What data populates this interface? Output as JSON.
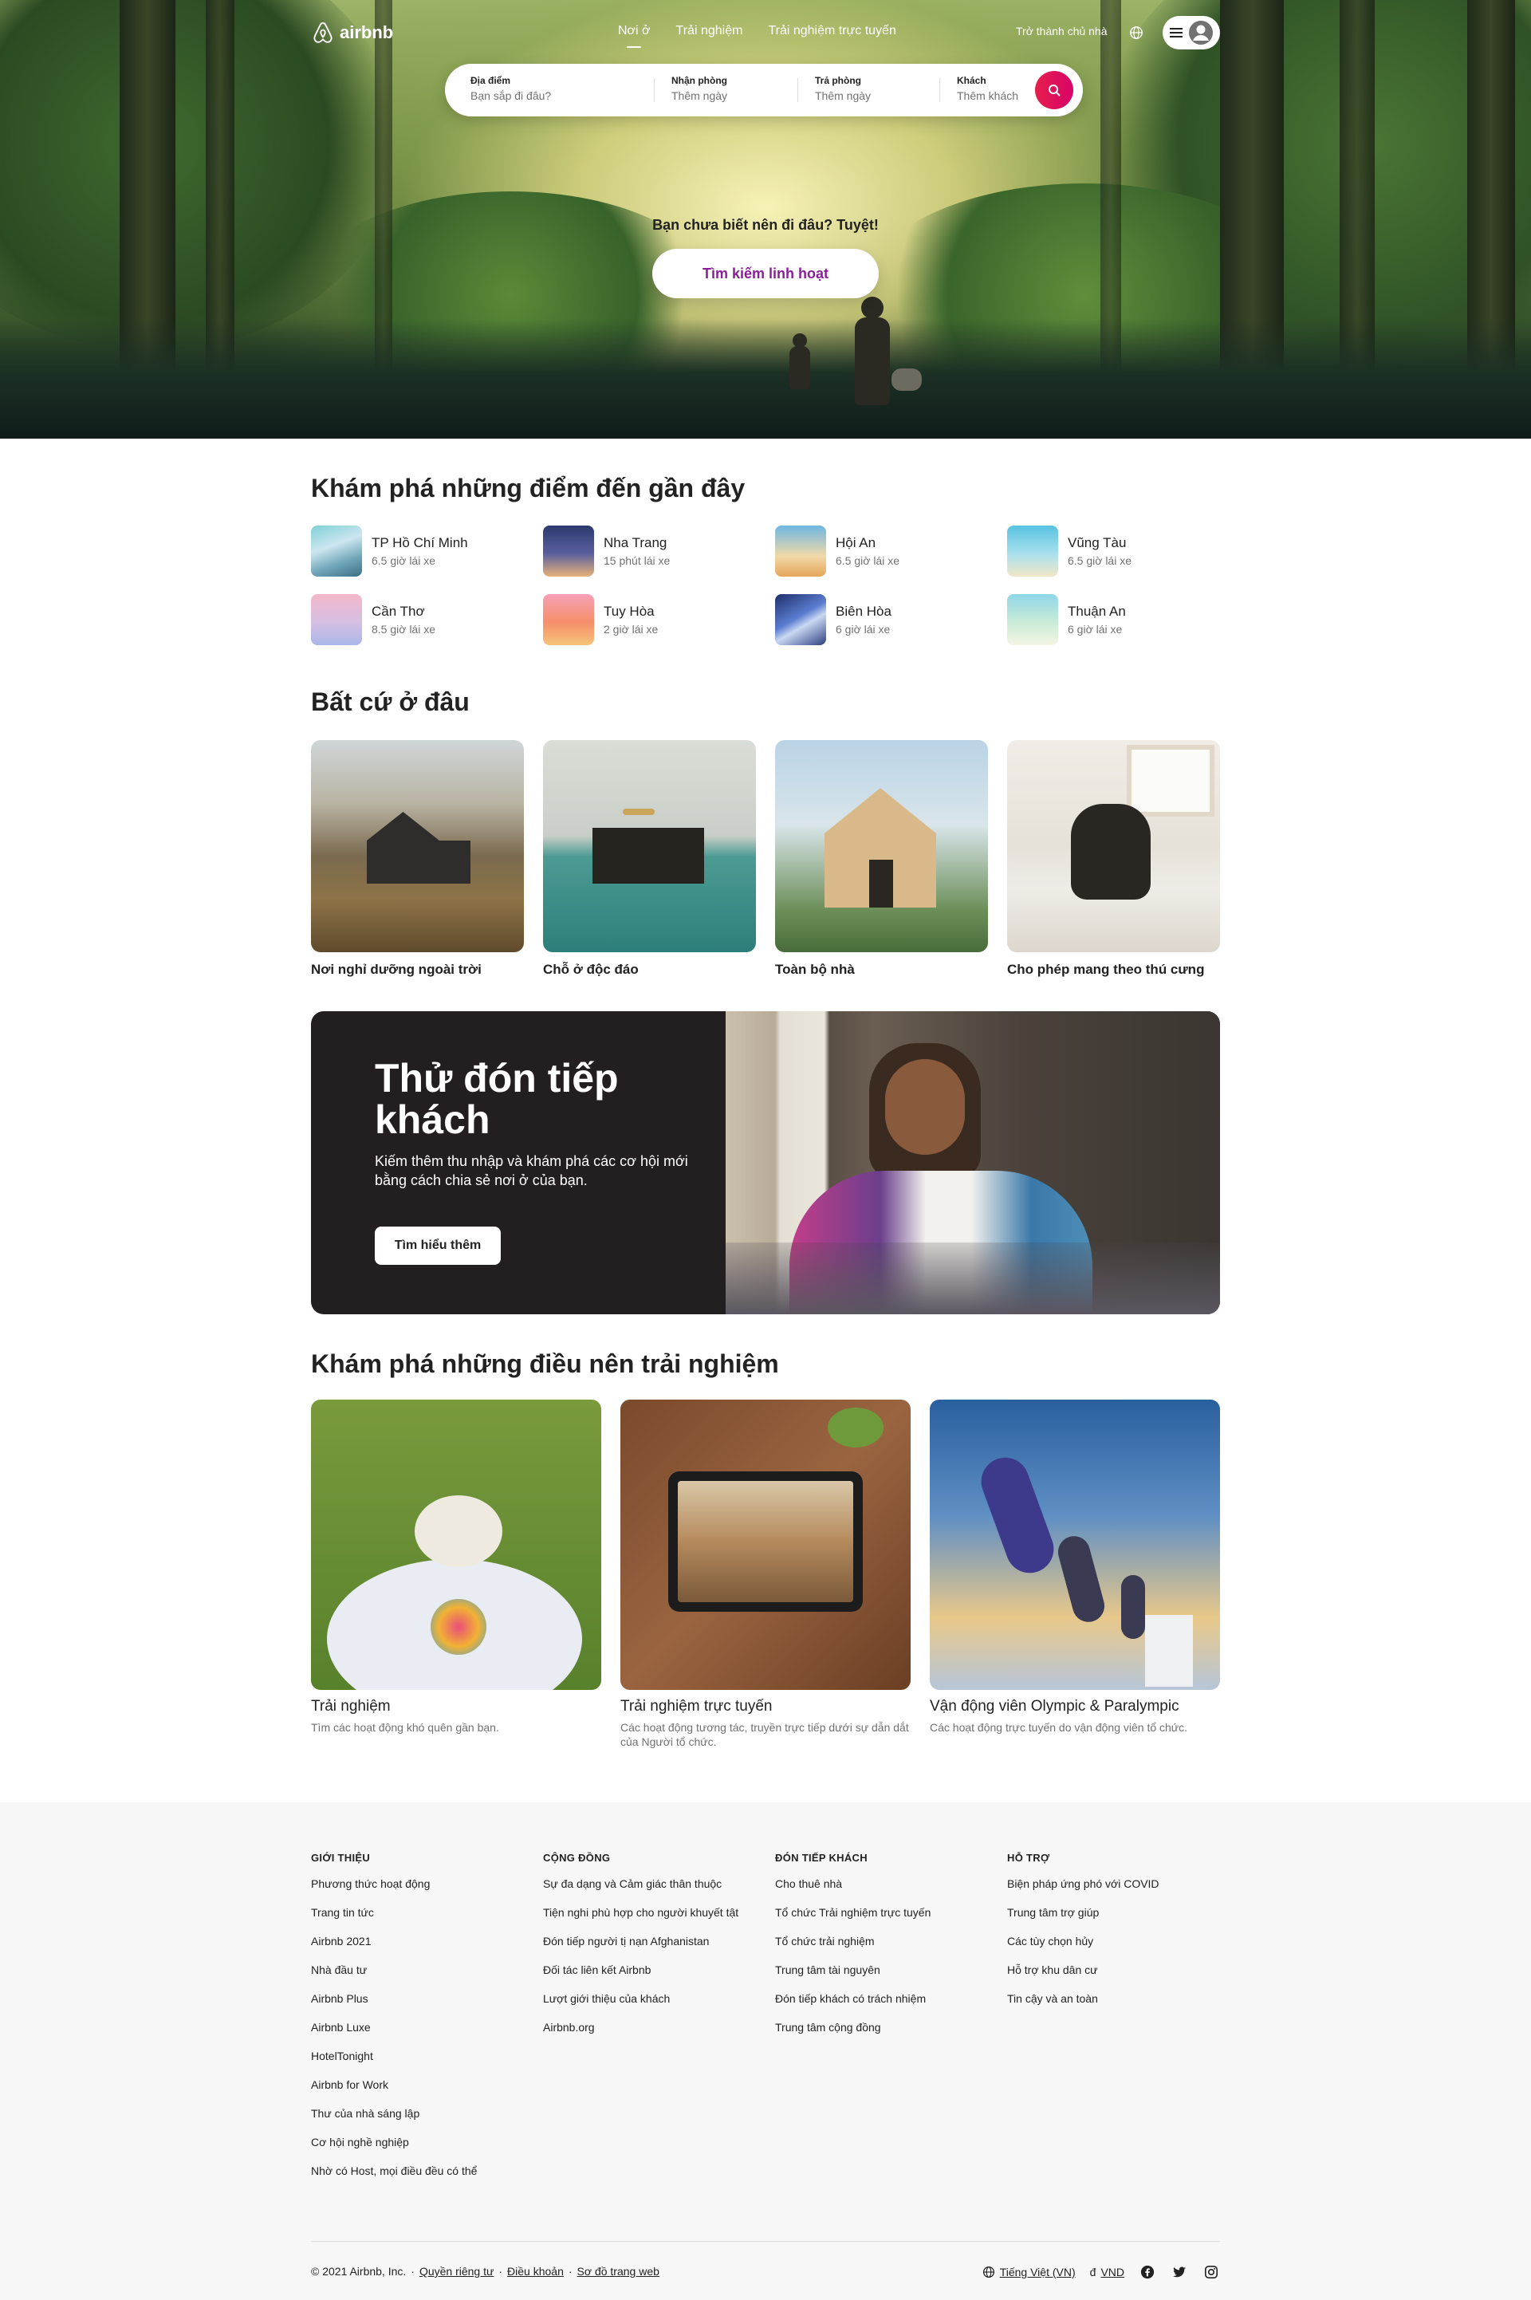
{
  "header": {
    "logo_text": "airbnb",
    "tabs": [
      {
        "label": "Nơi ở",
        "active": true
      },
      {
        "label": "Trải nghiệm",
        "active": false
      },
      {
        "label": "Trải nghiệm trực tuyến",
        "active": false
      }
    ],
    "host_link": "Trở thành chủ nhà",
    "icons": {
      "globe": "globe-icon",
      "menu": "hamburger-icon",
      "avatar": "user-avatar-icon"
    }
  },
  "search": {
    "fields": [
      {
        "label": "Địa điểm",
        "placeholder": "Bạn sắp đi đâu?"
      },
      {
        "label": "Nhận phòng",
        "placeholder": "Thêm ngày"
      },
      {
        "label": "Trả phòng",
        "placeholder": "Thêm ngày"
      },
      {
        "label": "Khách",
        "placeholder": "Thêm khách"
      }
    ],
    "button_icon": "search-icon"
  },
  "hero": {
    "prompt": "Bạn chưa biết nên đi đâu? Tuyệt!",
    "flex_button": "Tìm kiếm linh hoạt"
  },
  "nearby": {
    "title": "Khám phá những điểm đến gần đây",
    "items": [
      {
        "name": "TP Hồ Chí Minh",
        "time": "6.5 giờ lái xe"
      },
      {
        "name": "Nha Trang",
        "time": "15 phút lái xe"
      },
      {
        "name": "Hội An",
        "time": "6.5 giờ lái xe"
      },
      {
        "name": "Vũng Tàu",
        "time": "6.5 giờ lái xe"
      },
      {
        "name": "Cần Thơ",
        "time": "8.5 giờ lái xe"
      },
      {
        "name": "Tuy Hòa",
        "time": "2 giờ lái xe"
      },
      {
        "name": "Biên Hòa",
        "time": "6 giờ lái xe"
      },
      {
        "name": "Thuận An",
        "time": "6 giờ lái xe"
      }
    ]
  },
  "anywhere": {
    "title": "Bất cứ ở đâu",
    "cards": [
      {
        "label": "Nơi nghỉ dưỡng ngoài trời"
      },
      {
        "label": "Chỗ ở độc đáo"
      },
      {
        "label": "Toàn bộ nhà"
      },
      {
        "label": "Cho phép mang theo thú cưng"
      }
    ]
  },
  "host_banner": {
    "title": "Thử đón tiếp khách",
    "description": "Kiếm thêm thu nhập và khám phá các cơ hội mới bằng cách chia sẻ nơi ở của bạn.",
    "cta": "Tìm hiểu thêm"
  },
  "experiences": {
    "title": "Khám phá những điều nên trải nghiệm",
    "cards": [
      {
        "title": "Trải nghiệm",
        "subtitle": "Tìm các hoạt động khó quên gần bạn."
      },
      {
        "title": "Trải nghiệm trực tuyến",
        "subtitle": "Các hoạt động tương tác, truyền trực tiếp dưới sự dẫn dắt của Người tổ chức."
      },
      {
        "title": "Vận động viên Olympic & Paralympic",
        "subtitle": "Các hoạt động trực tuyến do vận động viên tổ chức."
      }
    ]
  },
  "footer": {
    "columns": [
      {
        "heading": "GIỚI THIỆU",
        "links": [
          "Phương thức hoạt động",
          "Trang tin tức",
          "Airbnb 2021",
          "Nhà đầu tư",
          "Airbnb Plus",
          "Airbnb Luxe",
          "HotelTonight",
          "Airbnb for Work",
          "Thư của nhà sáng lập",
          "Cơ hội nghề nghiệp",
          "Nhờ có Host, mọi điều đều có thể"
        ]
      },
      {
        "heading": "CỘNG ĐỒNG",
        "links": [
          "Sự đa dạng và Cảm giác thân thuộc",
          "Tiện nghi phù hợp cho người khuyết tật",
          "Đón tiếp người tị nạn Afghanistan",
          "Đối tác liên kết Airbnb",
          "Lượt giới thiệu của khách",
          "Airbnb.org"
        ]
      },
      {
        "heading": "ĐÓN TIẾP KHÁCH",
        "links": [
          "Cho thuê nhà",
          "Tổ chức Trải nghiệm trực tuyến",
          "Tổ chức trải nghiệm",
          "Trung tâm tài nguyên",
          "Đón tiếp khách có trách nhiệm",
          "Trung tâm cộng đồng"
        ]
      },
      {
        "heading": "HỖ TRỢ",
        "links": [
          "Biện pháp ứng phó với COVID",
          "Trung tâm trợ giúp",
          "Các tùy chọn hủy",
          "Hỗ trợ khu dân cư",
          "Tin cậy và an toàn"
        ]
      }
    ],
    "copyright": "© 2021 Airbnb, Inc.",
    "legal_links": [
      "Quyền riêng tư",
      "Điều khoản",
      "Sơ đồ trang web"
    ],
    "separator": "·",
    "language": "Tiếng Việt (VN)",
    "currency_symbol": "đ",
    "currency": "VND",
    "social_icons": [
      "facebook-icon",
      "twitter-icon",
      "instagram-icon"
    ]
  },
  "colors": {
    "brand": "#FF385C",
    "search_button": "#E61E4D",
    "flex_button_text": "#8A1E9A",
    "footer_bg": "#F7F7F7"
  }
}
